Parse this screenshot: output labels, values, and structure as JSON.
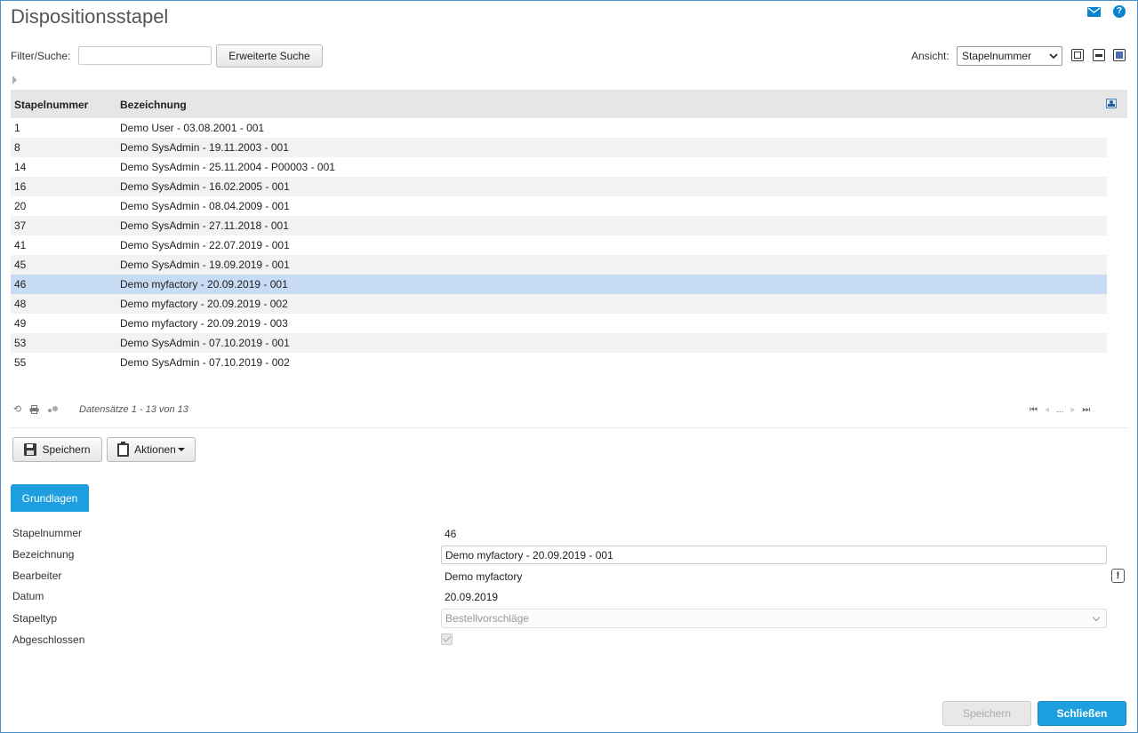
{
  "window": {
    "title": "Dispositionsstapel"
  },
  "toolbar": {
    "filter_label": "Filter/Suche:",
    "filter_value": "",
    "advanced_search_label": "Erweiterte Suche",
    "view_label": "Ansicht:",
    "view_selected": "Stapelnummer"
  },
  "grid": {
    "columns": [
      "Stapelnummer",
      "Bezeichnung"
    ],
    "rows": [
      {
        "nr": "1",
        "bez": "Demo User - 03.08.2001 - 001"
      },
      {
        "nr": "8",
        "bez": "Demo SysAdmin - 19.11.2003 - 001"
      },
      {
        "nr": "14",
        "bez": "Demo SysAdmin - 25.11.2004 - P00003 - 001"
      },
      {
        "nr": "16",
        "bez": "Demo SysAdmin - 16.02.2005 - 001"
      },
      {
        "nr": "20",
        "bez": "Demo SysAdmin - 08.04.2009 - 001"
      },
      {
        "nr": "37",
        "bez": "Demo SysAdmin - 27.11.2018 - 001"
      },
      {
        "nr": "41",
        "bez": "Demo SysAdmin - 22.07.2019 - 001"
      },
      {
        "nr": "45",
        "bez": "Demo SysAdmin - 19.09.2019 - 001"
      },
      {
        "nr": "46",
        "bez": "Demo myfactory - 20.09.2019 - 001"
      },
      {
        "nr": "48",
        "bez": "Demo myfactory - 20.09.2019 - 002"
      },
      {
        "nr": "49",
        "bez": "Demo myfactory - 20.09.2019 - 003"
      },
      {
        "nr": "53",
        "bez": "Demo SysAdmin - 07.10.2019 - 001"
      },
      {
        "nr": "55",
        "bez": "Demo SysAdmin - 07.10.2019 - 002"
      }
    ],
    "selected_row": 8,
    "records_text": "Datensätze 1 - 13 von 13",
    "pager_ellipsis": "..."
  },
  "actions": {
    "save_label": "Speichern",
    "actions_label": "Aktionen"
  },
  "tabs": [
    {
      "label": "Grundlagen",
      "active": true
    }
  ],
  "form": {
    "stapelnummer_label": "Stapelnummer",
    "stapelnummer_value": "46",
    "bezeichnung_label": "Bezeichnung",
    "bezeichnung_value": "Demo myfactory - 20.09.2019 - 001",
    "bearbeiter_label": "Bearbeiter",
    "bearbeiter_value": "Demo myfactory",
    "datum_label": "Datum",
    "datum_value": "20.09.2019",
    "stapeltyp_label": "Stapeltyp",
    "stapeltyp_value": "Bestellvorschläge",
    "abgeschlossen_label": "Abgeschlossen",
    "abgeschlossen_checked": true
  },
  "footer": {
    "save_label": "Speichern",
    "close_label": "Schließen"
  },
  "icons": {
    "mail": "mail-icon",
    "help": "help-icon",
    "column_chooser": "column-chooser-icon",
    "refresh": "refresh-icon",
    "print": "print-icon",
    "settings": "settings-icon",
    "save": "floppy-icon",
    "actions": "clipboard-icon"
  },
  "colors": {
    "accent": "#1e9fe0",
    "selected_row": "#c7dbf5",
    "header_bg": "#e6e6e6"
  }
}
